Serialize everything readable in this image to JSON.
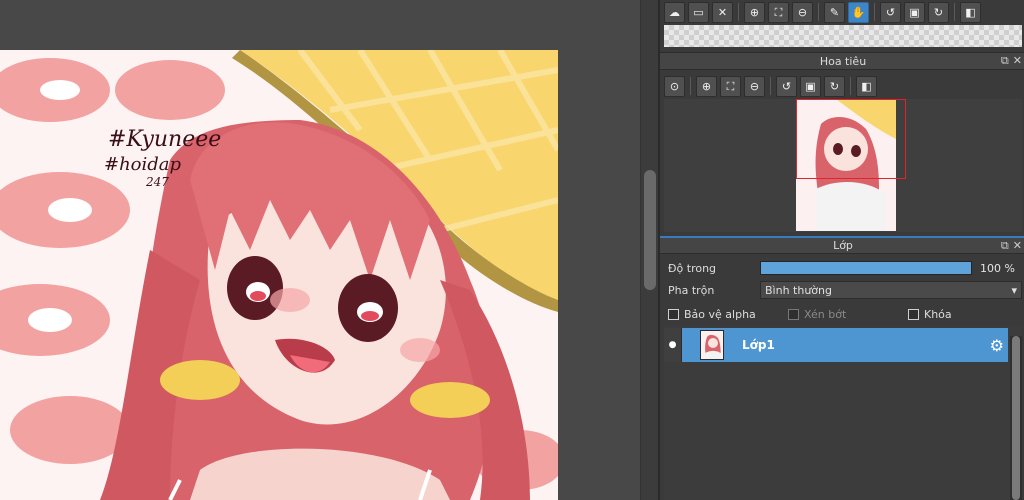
{
  "colors": {
    "panel_bg": "#3a3a3a",
    "accent_blue": "#4d96d1",
    "active_tool": "#3f86c8",
    "nav_frame": "#e0242a"
  },
  "artwork": {
    "signature_line1": "#Kyuneee",
    "signature_line2": "#hoidap",
    "signature_line3": "247"
  },
  "top_toolbar": {
    "icons": [
      "cloud-upload-icon",
      "folder-icon",
      "close-icon",
      "zoom-in-icon",
      "fit-screen-icon",
      "zoom-out-icon",
      "eyedropper-icon",
      "hand-icon",
      "rotate-left-icon",
      "reset-view-icon",
      "rotate-right-icon",
      "flip-icon"
    ],
    "active_tool": "hand-icon"
  },
  "navigator": {
    "title": "Hoa tiêu",
    "icons": [
      "zoom-actual-icon",
      "zoom-in-icon",
      "fit-screen-icon",
      "zoom-out-icon",
      "rotate-left-icon",
      "reset-view-icon",
      "rotate-right-icon",
      "flip-icon"
    ]
  },
  "layers": {
    "title": "Lớp",
    "opacity_label": "Độ trong",
    "opacity_value": "100 %",
    "opacity_fraction": 1.0,
    "blend_label": "Pha trộn",
    "blend_value": "Bình thường",
    "protect_alpha_label": "Bảo vệ alpha",
    "clipping_label": "Xén bớt",
    "lock_label": "Khóa",
    "items": [
      {
        "name": "Lớp1",
        "selected": true,
        "visible": true
      }
    ]
  }
}
